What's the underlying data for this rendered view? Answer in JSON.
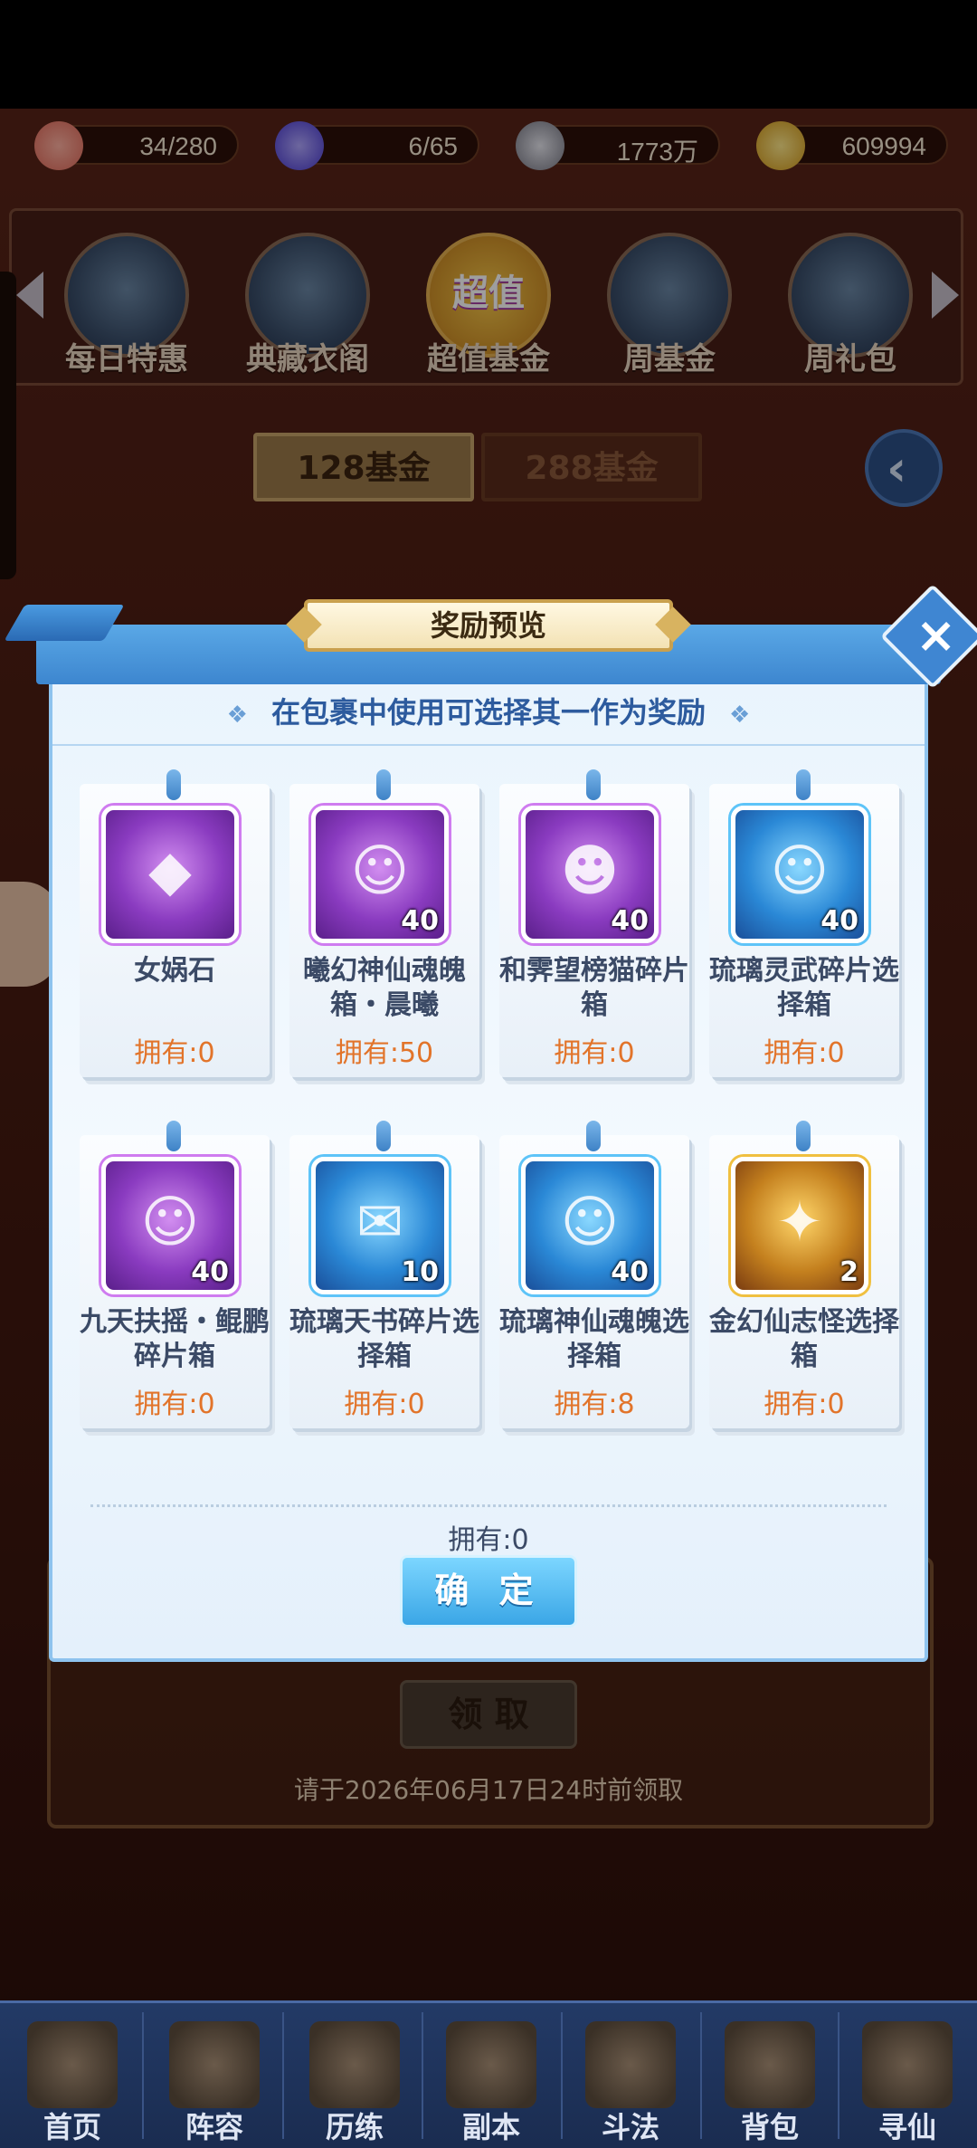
{
  "resources": [
    {
      "icon": "peach-icon",
      "value": "34/280",
      "color": "#f28a7a"
    },
    {
      "icon": "flame-icon",
      "value": "6/65",
      "color": "#6a5ae6"
    },
    {
      "icon": "coin-icon",
      "value": "1773万",
      "color": "#b8b8c0"
    },
    {
      "icon": "gold-ingot-icon",
      "value": "609994",
      "color": "#f0c040"
    }
  ],
  "shop_tabs": [
    {
      "label": "每日特惠",
      "icon": "gift-box-icon"
    },
    {
      "label": "典藏衣阁",
      "icon": "treasure-chest-icon"
    },
    {
      "label": "超值基金",
      "icon": "super-value-badge-icon",
      "badge": "超值"
    },
    {
      "label": "周基金",
      "icon": "gold-ingots-icon"
    },
    {
      "label": "周礼包",
      "icon": "gift-package-icon"
    }
  ],
  "fund_tabs": {
    "active": "128基金",
    "inactive": "288基金"
  },
  "dialog": {
    "title": "奖励预览",
    "subtitle": "在包裹中使用可选择其一作为奖励",
    "items": [
      {
        "name": "女娲石",
        "owned": "拥有:0",
        "qty": "",
        "style": "purple",
        "glyph": "◆"
      },
      {
        "name": "曦幻神仙魂魄箱・晨曦",
        "owned": "拥有:50",
        "qty": "40",
        "style": "purple",
        "glyph": "☺"
      },
      {
        "name": "和霁望榜猫碎片箱",
        "owned": "拥有:0",
        "qty": "40",
        "style": "purple",
        "glyph": "☻"
      },
      {
        "name": "琉璃灵武碎片选择箱",
        "owned": "拥有:0",
        "qty": "40",
        "style": "blue",
        "glyph": "☺"
      },
      {
        "name": "九天扶摇・鲲鹏碎片箱",
        "owned": "拥有:0",
        "qty": "40",
        "style": "purple",
        "glyph": "☺"
      },
      {
        "name": "琉璃天书碎片选择箱",
        "owned": "拥有:0",
        "qty": "10",
        "style": "blue",
        "glyph": "✉"
      },
      {
        "name": "琉璃神仙魂魄选择箱",
        "owned": "拥有:8",
        "qty": "40",
        "style": "blue",
        "glyph": "☺"
      },
      {
        "name": "金幻仙志怪选择箱",
        "owned": "拥有:0",
        "qty": "2",
        "style": "gold",
        "glyph": "✦"
      }
    ],
    "owned_total": "拥有:0",
    "confirm_label": "确 定"
  },
  "background": {
    "claim_label": "领 取",
    "deadline": "请于2026年06月17日24时前领取"
  },
  "nav": [
    {
      "label": "首页",
      "icon": "home-icon"
    },
    {
      "label": "阵容",
      "icon": "lineup-cards-icon"
    },
    {
      "label": "历练",
      "icon": "training-icon"
    },
    {
      "label": "副本",
      "icon": "dungeon-gate-icon"
    },
    {
      "label": "斗法",
      "icon": "battle-icon"
    },
    {
      "label": "背包",
      "icon": "backpack-icon"
    },
    {
      "label": "寻仙",
      "icon": "scroll-icon"
    }
  ]
}
